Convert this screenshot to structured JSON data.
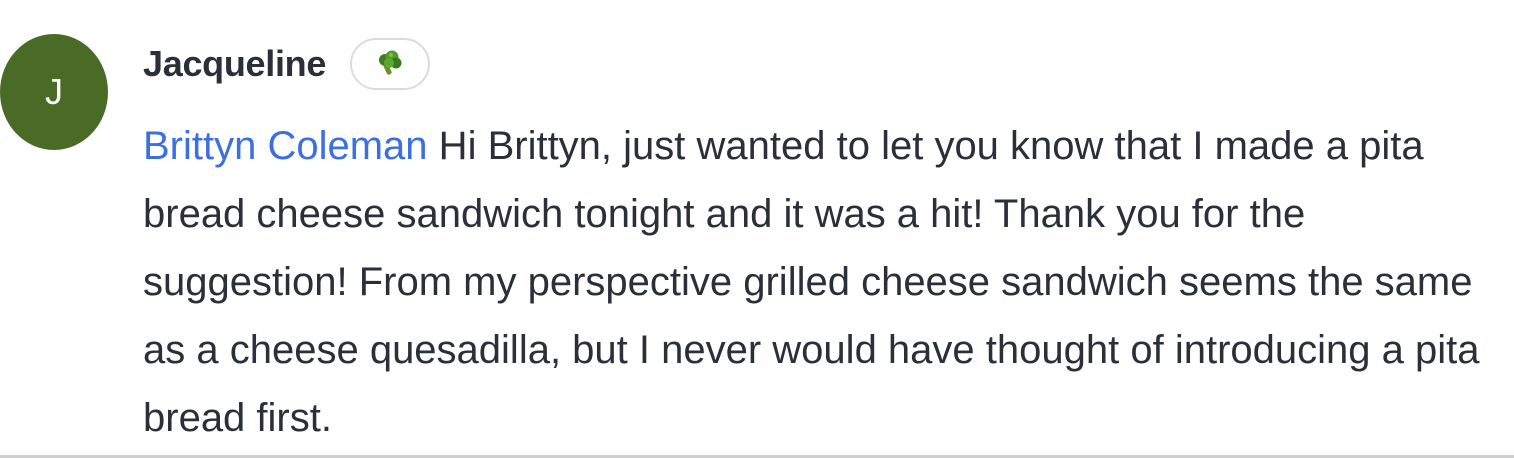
{
  "comment": {
    "avatar_initial": "J",
    "avatar_color": "#4a6b25",
    "author": "Jacqueline",
    "badge_icon": "broccoli-icon",
    "mention": "Brittyn Coleman",
    "mention_color": "#3d6fe0",
    "text": " Hi Brittyn, just wanted to let you know that I made a pita bread cheese sandwich tonight and it was a hit! Thank you for the suggestion! From my perspective grilled cheese sandwich seems the same as a cheese quesadilla, but I never would have thought of introducing a pita bread first."
  }
}
